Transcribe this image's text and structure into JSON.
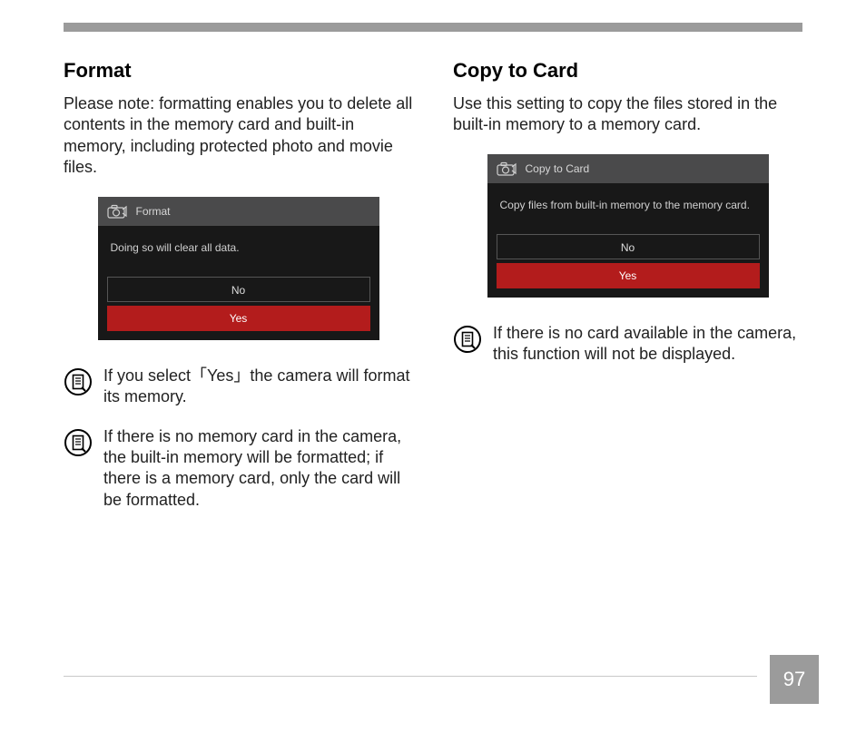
{
  "left": {
    "heading": "Format",
    "intro": "Please note: formatting enables you to delete all contents in the memory card and built-in memory, including protected photo and movie files.",
    "dialog": {
      "title": "Format",
      "message": "Doing so will clear all data.",
      "option_no": "No",
      "option_yes": "Yes"
    },
    "note1": "If you select「Yes」the camera will format its memory.",
    "note2": "If there is no memory card in the camera, the built-in memory will be formatted; if there is a memory card, only the card will be formatted."
  },
  "right": {
    "heading": "Copy to Card",
    "intro": "Use this setting to copy the files stored in the built-in memory to a memory card.",
    "dialog": {
      "title": "Copy to Card",
      "message": "Copy files from built-in memory to the memory card.",
      "option_no": "No",
      "option_yes": "Yes"
    },
    "note1": "If there is no card available in the camera, this function will not be displayed."
  },
  "page_number": "97"
}
